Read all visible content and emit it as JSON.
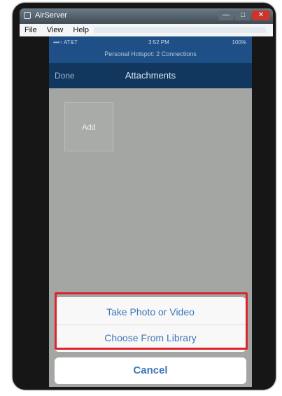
{
  "window": {
    "title": "AirServer",
    "minimize_glyph": "—",
    "maximize_glyph": "□",
    "close_glyph": "✕"
  },
  "menu": {
    "items": [
      "File",
      "View",
      "Help"
    ]
  },
  "status": {
    "carrier": "•••○ AT&T",
    "time": "3:52 PM",
    "battery": "100%",
    "hotspot": "Personal Hotspot: 2 Connections"
  },
  "nav": {
    "done_label": "Done",
    "title": "Attachments"
  },
  "attachment": {
    "tile_label": "Add"
  },
  "action_sheet": {
    "take_photo_label": "Take Photo or Video",
    "choose_library_label": "Choose From Library",
    "cancel_label": "Cancel",
    "highlight_color": "#d8262c"
  },
  "colors": {
    "status_bar": "#1e4f86",
    "nav_bar": "#11375f",
    "action_text": "#3f77b8",
    "screen_overlay": "#a3a6a3"
  },
  "icons": [
    "app-icon"
  ]
}
